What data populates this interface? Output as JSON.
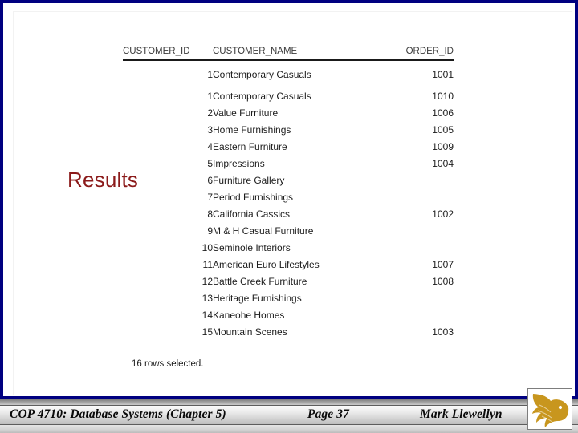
{
  "slide": {
    "caption": "Results",
    "caption_color": "#8b1a1a",
    "border_color": "#000080"
  },
  "result_grid": {
    "columns": [
      "CUSTOMER_ID",
      "CUSTOMER_NAME",
      "ORDER_ID"
    ],
    "rows": [
      {
        "customer_id": "1",
        "customer_name": "Contemporary Casuals",
        "order_id": "1001"
      },
      {
        "customer_id": "1",
        "customer_name": "Contemporary Casuals",
        "order_id": "1010"
      },
      {
        "customer_id": "2",
        "customer_name": "Value Furniture",
        "order_id": "1006"
      },
      {
        "customer_id": "3",
        "customer_name": "Home Furnishings",
        "order_id": "1005"
      },
      {
        "customer_id": "4",
        "customer_name": "Eastern Furniture",
        "order_id": "1009"
      },
      {
        "customer_id": "5",
        "customer_name": "Impressions",
        "order_id": "1004"
      },
      {
        "customer_id": "6",
        "customer_name": "Furniture Gallery",
        "order_id": ""
      },
      {
        "customer_id": "7",
        "customer_name": "Period Furnishings",
        "order_id": ""
      },
      {
        "customer_id": "8",
        "customer_name": "California Cassics",
        "order_id": "1002"
      },
      {
        "customer_id": "9",
        "customer_name": "M & H Casual Furniture",
        "order_id": ""
      },
      {
        "customer_id": "10",
        "customer_name": "Seminole Interiors",
        "order_id": ""
      },
      {
        "customer_id": "11",
        "customer_name": "American Euro Lifestyles",
        "order_id": "1007"
      },
      {
        "customer_id": "12",
        "customer_name": "Battle Creek Furniture",
        "order_id": "1008"
      },
      {
        "customer_id": "13",
        "customer_name": "Heritage Furnishings",
        "order_id": ""
      },
      {
        "customer_id": "14",
        "customer_name": "Kaneohe Homes",
        "order_id": ""
      },
      {
        "customer_id": "15",
        "customer_name": "Mountain Scenes",
        "order_id": "1003"
      }
    ],
    "status": "16 rows selected."
  },
  "footer": {
    "course": "COP 4710: Database Systems  (Chapter 5)",
    "page": "Page 37",
    "author": "Mark Llewellyn",
    "logo": "ucf-pegasus-logo",
    "logo_color": "#C8961E"
  }
}
